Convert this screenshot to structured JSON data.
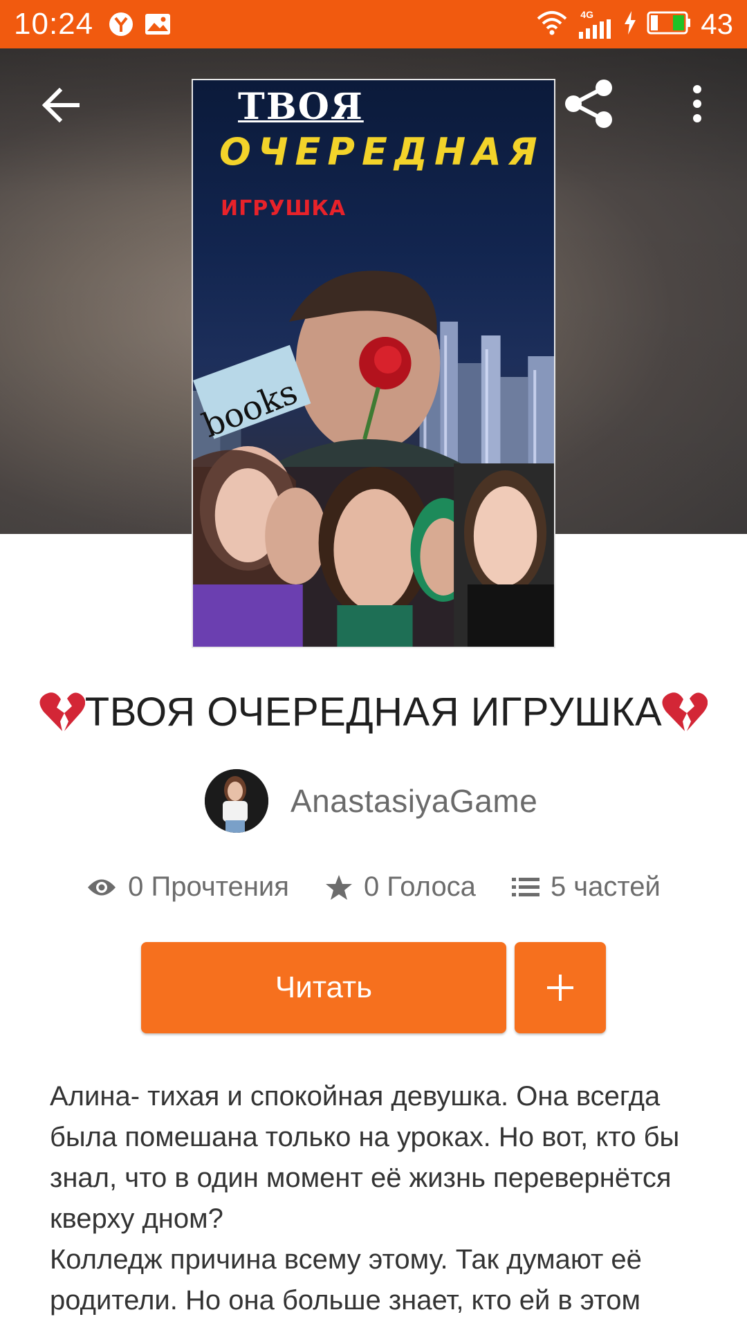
{
  "status_bar": {
    "time": "10:24",
    "network": "4G",
    "battery": "43",
    "colors": {
      "bar": "#f15a0f"
    }
  },
  "header": {
    "back_icon": "arrow-left-icon",
    "share_icon": "share-icon",
    "more_icon": "more-vertical-icon"
  },
  "cover": {
    "line1": "ТВОЯ",
    "line2": "ОЧЕРЕДНАЯ",
    "line3": "ИГРУШКА",
    "brand": "books"
  },
  "story": {
    "title": "ТВОЯ ОЧЕРЕДНАЯ ИГРУШКА",
    "title_decoration_icon": "broken-heart-icon",
    "author": "AnastasiyaGame"
  },
  "stats": {
    "reads": "0 Прочтения",
    "votes": "0 Голоса",
    "parts": "5 частей"
  },
  "actions": {
    "read_label": "Читать",
    "add_icon": "plus-icon",
    "accent": "#f6701e"
  },
  "description": {
    "paragraph1": "Алина- тихая и спокойная девушка. Она всегда была помешана только на уроках. Но вот, кто бы знал, что в один момент её жизнь перевернётся кверху дном?",
    "paragraph2": "Колледж причина всему этому. Так думают её родители. Но она больше знает, кто ей в этом"
  }
}
